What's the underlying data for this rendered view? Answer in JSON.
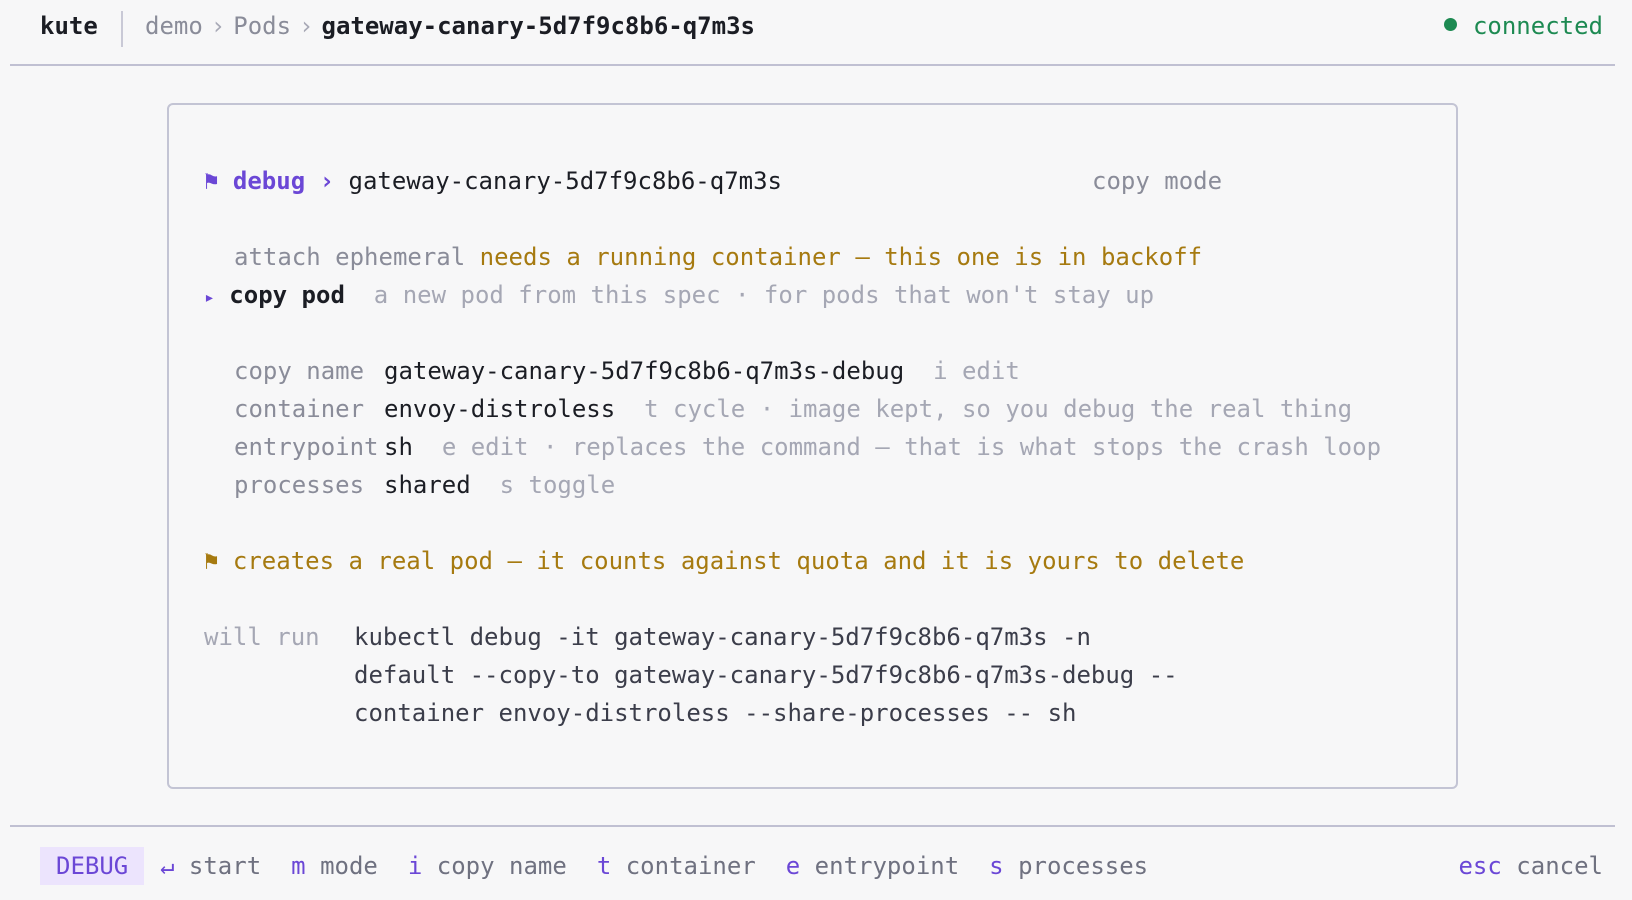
{
  "app": {
    "name": "kute"
  },
  "breadcrumb": {
    "items": [
      "demo",
      "Pods"
    ],
    "current": "gateway-canary-5d7f9c8b6-q7m3s",
    "separator": "›"
  },
  "status": {
    "label": "connected",
    "color": "#1d8a52"
  },
  "panel": {
    "header": {
      "icon": "flag-icon",
      "label": "debug",
      "separator": "›",
      "pod": "gateway-canary-5d7f9c8b6-q7m3s",
      "mode": "copy mode"
    },
    "options": [
      {
        "label": "attach ephemeral",
        "note": "needs a running container — this one is in backoff",
        "selected": false
      },
      {
        "label": "copy pod",
        "note": "a new pod from this spec · for pods that won't stay up",
        "selected": true
      }
    ],
    "fields": [
      {
        "label": "copy name",
        "value": "gateway-canary-5d7f9c8b6-q7m3s-debug",
        "hint": "i edit"
      },
      {
        "label": "container",
        "value": "envoy-distroless",
        "hint": "t cycle · image kept, so you debug the real thing"
      },
      {
        "label": "entrypoint",
        "value": "sh",
        "hint": "e edit · replaces the command — that is what stops the crash loop"
      },
      {
        "label": "processes",
        "value": "shared",
        "hint": "s toggle"
      }
    ],
    "warning": {
      "icon": "flag-icon",
      "text": "creates a real pod — it counts against quota and it is yours to delete"
    },
    "command": {
      "label": "will run",
      "lines": [
        "kubectl debug -it gateway-canary-5d7f9c8b6-q7m3s -n",
        "default --copy-to gateway-canary-5d7f9c8b6-q7m3s-debug --",
        "container envoy-distroless --share-processes -- sh"
      ]
    }
  },
  "footer": {
    "mode": "DEBUG",
    "keys": [
      {
        "key": "↵",
        "label": "start"
      },
      {
        "key": "m",
        "label": "mode"
      },
      {
        "key": "i",
        "label": "copy name"
      },
      {
        "key": "t",
        "label": "container"
      },
      {
        "key": "e",
        "label": "entrypoint"
      },
      {
        "key": "s",
        "label": "processes"
      }
    ],
    "cancel": {
      "key": "esc",
      "label": "cancel"
    }
  },
  "colors": {
    "accent": "#6b47d6",
    "warning": "#a67a10",
    "success": "#1d8a52",
    "muted": "#8a8c99"
  }
}
